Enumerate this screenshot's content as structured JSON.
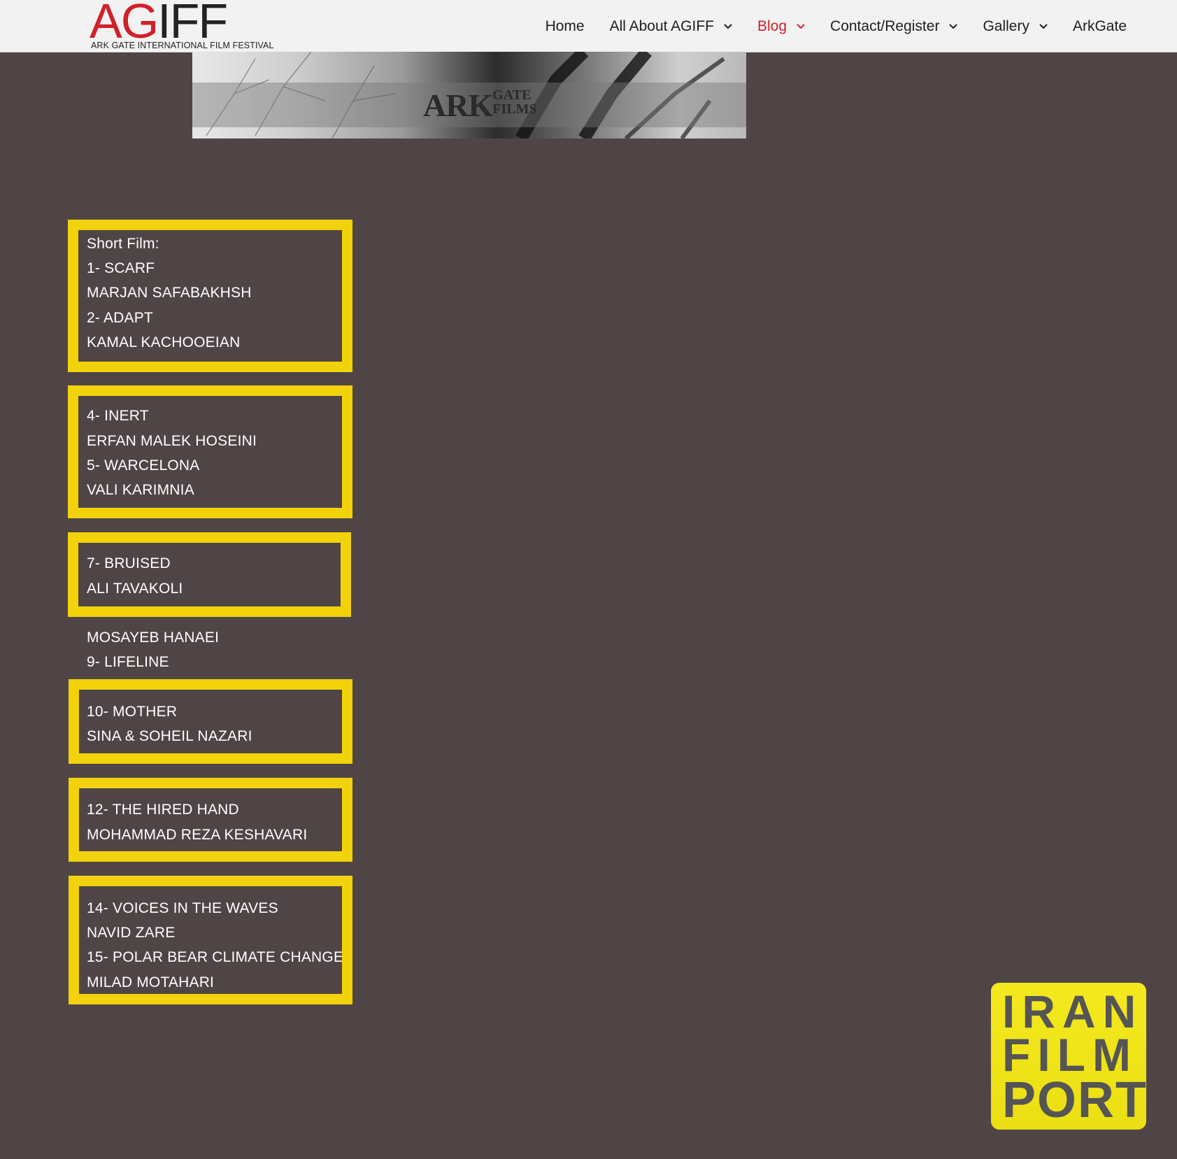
{
  "header": {
    "logo": {
      "mark": "AGIFF",
      "subtitle": "ARK GATE INTERNATIONAL FILM FESTIVAL"
    },
    "nav": [
      {
        "label": "Home",
        "has_dropdown": false,
        "active": false
      },
      {
        "label": "All About AGIFF",
        "has_dropdown": true,
        "active": false
      },
      {
        "label": "Blog",
        "has_dropdown": true,
        "active": true
      },
      {
        "label": "Contact/Register",
        "has_dropdown": true,
        "active": false
      },
      {
        "label": "Gallery",
        "has_dropdown": true,
        "active": false
      },
      {
        "label": "ArkGate",
        "has_dropdown": false,
        "active": false
      }
    ]
  },
  "banner": {
    "text_big": "ARK",
    "text_small_1": "GATE",
    "text_small_2": "FILMS"
  },
  "film_list": {
    "lines": [
      "Short Film:",
      "1- SCARF",
      "MARJAN SAFABAKHSH",
      "2- ADAPT",
      "KAMAL KACHOOEIAN",
      "",
      "",
      "4- INERT",
      "ERFAN MALEK HOSEINI",
      "5- WARCELONA",
      "VALI KARIMNIA",
      "",
      "",
      "7- BRUISED",
      "ALI TAVAKOLI",
      "",
      "MOSAYEB HANAEI",
      "9- LIFELINE",
      "",
      "10- MOTHER",
      "SINA & SOHEIL NAZARI",
      "",
      "",
      "12- THE HIRED HAND",
      "MOHAMMAD REZA KESHAVARI",
      "",
      "",
      "14- VOICES IN THE WAVES",
      "NAVID ZARE",
      "15- POLAR BEAR CLIMATE CHANGE",
      "MILAD MOTAHARI"
    ]
  },
  "watermark": {
    "lines": [
      "IRAN",
      "FILM",
      "PORT"
    ]
  },
  "colors": {
    "accent_red": "#d0212a",
    "highlight_yellow": "#f2d20b",
    "page_bg": "#504546"
  }
}
